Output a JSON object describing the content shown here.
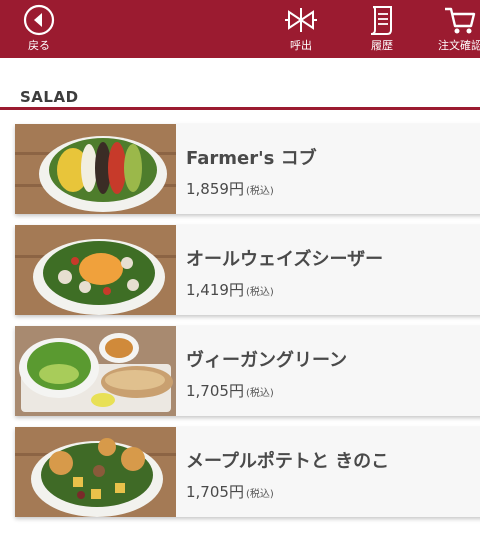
{
  "header": {
    "back_label": "戻る",
    "call_label": "呼出",
    "history_label": "履歴",
    "order_confirm_label": "注文確認",
    "bg_color": "#9b1b30"
  },
  "section": {
    "title": "SALAD"
  },
  "items": [
    {
      "name": "Farmer's コブ",
      "price": "1,859円",
      "tax": "(税込)"
    },
    {
      "name": "オールウェイズシーザー",
      "price": "1,419円",
      "tax": "(税込)"
    },
    {
      "name": "ヴィーガングリーン",
      "price": "1,705円",
      "tax": "(税込)"
    },
    {
      "name": "メープルポテトと きのこ",
      "price": "1,705円",
      "tax": "(税込)"
    }
  ]
}
